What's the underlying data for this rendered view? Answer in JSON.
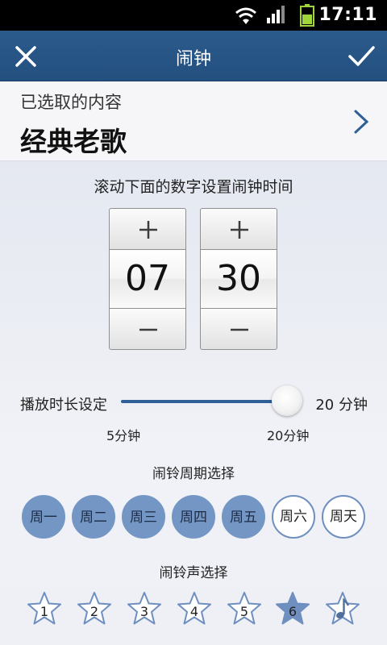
{
  "status_bar": {
    "time": "17:11"
  },
  "header": {
    "title": "闹钟",
    "close_icon": "close-icon",
    "confirm_icon": "check-icon"
  },
  "selected": {
    "label": "已选取的内容",
    "value": "经典老歌"
  },
  "time_picker": {
    "hint": "滚动下面的数字设置闹钟时间",
    "hour": "07",
    "minute": "30"
  },
  "duration": {
    "label": "播放时长设定",
    "value_text": "20 分钟",
    "min_label": "5分钟",
    "max_label": "20分钟",
    "value_fraction": 1.0
  },
  "period": {
    "title": "闹铃周期选择",
    "days": [
      {
        "label": "周一",
        "selected": true
      },
      {
        "label": "周二",
        "selected": true
      },
      {
        "label": "周三",
        "selected": true
      },
      {
        "label": "周四",
        "selected": true
      },
      {
        "label": "周五",
        "selected": true
      },
      {
        "label": "周六",
        "selected": false
      },
      {
        "label": "周天",
        "selected": false
      }
    ]
  },
  "ringtone": {
    "title": "闹铃声选择",
    "options": [
      "1",
      "2",
      "3",
      "4",
      "5",
      "6",
      ""
    ],
    "selected_index": 5,
    "last_icon": "music-note-icon"
  },
  "colors": {
    "titlebar": "#23507f",
    "accent": "#2e5f97",
    "day_selected": "#7496c4"
  }
}
